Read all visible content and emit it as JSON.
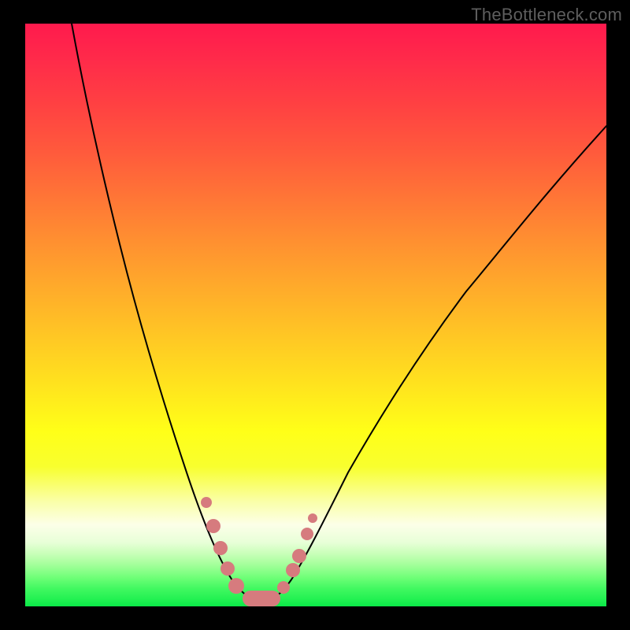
{
  "watermark": "TheBottleneck.com",
  "colors": {
    "dot": "#d67b7e",
    "curve": "#000000"
  },
  "chart_data": {
    "type": "line",
    "title": "",
    "xlabel": "",
    "ylabel": "",
    "xlim": [
      0,
      100
    ],
    "ylim": [
      0,
      100
    ],
    "note": "Bottleneck percentage curve; axis values are percentages. Curve minimum (~0%) near x≈39. Values estimated from figure.",
    "series": [
      {
        "name": "bottleneck-curve",
        "x": [
          8,
          10,
          14,
          18,
          22,
          26,
          30,
          32,
          34,
          36,
          38,
          40,
          42,
          44,
          46,
          48,
          52,
          56,
          60,
          66,
          74,
          82,
          90,
          100
        ],
        "y": [
          100,
          93,
          80,
          66,
          53,
          40,
          27,
          21,
          15,
          10,
          5,
          2,
          2,
          4,
          8,
          13,
          22,
          30,
          38,
          48,
          60,
          69,
          77,
          85
        ]
      }
    ],
    "markers": [
      {
        "x": 32,
        "y": 18,
        "size": 7
      },
      {
        "x": 33,
        "y": 13,
        "size": 9
      },
      {
        "x": 34,
        "y": 9,
        "size": 9
      },
      {
        "x": 35,
        "y": 6,
        "size": 9
      },
      {
        "x": 36.5,
        "y": 3,
        "size": 10
      },
      {
        "x": 38,
        "y": 1.5,
        "size": 10
      },
      {
        "x": 40,
        "y": 1.2,
        "size": 10
      },
      {
        "x": 42,
        "y": 1.5,
        "size": 10
      },
      {
        "x": 44,
        "y": 3.5,
        "size": 8
      },
      {
        "x": 45.5,
        "y": 6.5,
        "size": 9
      },
      {
        "x": 46.5,
        "y": 9,
        "size": 9
      },
      {
        "x": 48,
        "y": 13,
        "size": 8
      },
      {
        "x": 49,
        "y": 16,
        "size": 6
      }
    ]
  }
}
